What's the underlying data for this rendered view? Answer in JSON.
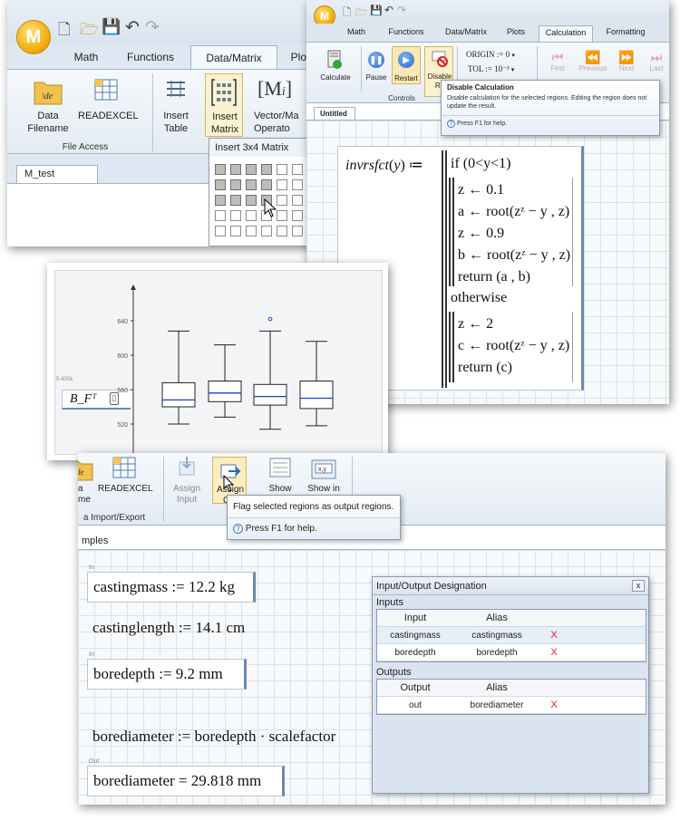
{
  "panel_a": {
    "app_logo": "M",
    "tabs": [
      "Math",
      "Functions",
      "Data/Matrix",
      "Plots"
    ],
    "active_tab": "Data/Matrix",
    "buttons": {
      "data_filename": "Data\nFilename",
      "readexcel": "READEXCEL",
      "insert_table": "Insert\nTable",
      "insert_matrix": "Insert\nMatrix",
      "vector_matrix": "Vector/Ma\nOperato"
    },
    "group_file_access": "File Access",
    "doc_tab": "M_test",
    "dropdown_title": "Insert 3x4 Matrix",
    "matrix_symbol": "M"
  },
  "panel_b": {
    "app_logo": "M",
    "tabs": [
      "Math",
      "Functions",
      "Data/Matrix",
      "Plots",
      "Calculation",
      "Formatting"
    ],
    "active_tab": "Calculation",
    "buttons": {
      "calculate": "Calculate",
      "pause": "Pause",
      "restart": "Restart",
      "disable": "Disable\nRe"
    },
    "options": {
      "origin": "ORIGIN := 0",
      "tol": "TOL := 10⁻³"
    },
    "nav": [
      "First",
      "Previous",
      "Next",
      "Last"
    ],
    "group_controls": "Controls",
    "doc_tab": "Untitled",
    "tooltip": {
      "title": "Disable Calculation",
      "body": "Disable calculation for the selected regions. Editing the region does not update the result.",
      "help": "Press F1 for help."
    },
    "program": {
      "header_name": "invrsfct",
      "header_arg": "y",
      "condition": "if (0<y<1)",
      "lines_if": [
        "z ← 0.1",
        "a ← root(zᶻ − y , z)",
        "z ← 0.9",
        "b ← root(zᶻ − y , z)",
        "return (a , b)"
      ],
      "otherwise": "otherwise",
      "lines_else": [
        "z ← 2",
        "c ← root(zᶻ − y , z)",
        "return (c)"
      ]
    }
  },
  "panel_c": {
    "region_expr": "B_Fᵀ",
    "tick_labels": [
      "640",
      "600",
      "560",
      "520"
    ],
    "side_label": "5-400k"
  },
  "panel_d": {
    "buttons": {
      "data_filename": "a\nme",
      "readexcel": "READEXCEL",
      "assign_input": "Assign\nInput",
      "assign_output": "Assign\nOut",
      "show": "Show",
      "show_in": "Show in"
    },
    "group_import_export": "a Import/Export",
    "doc_tab": "mples",
    "tooltip": {
      "title": "Flag selected regions as output regions.",
      "help": "Press F1 for help."
    },
    "worksheet": {
      "in_label": "In",
      "out_label": "Out",
      "casting_mass": "castingmass := 12.2 kg",
      "casting_length": "castinglength := 14.1 cm",
      "bore_depth": "boredepth := 9.2 mm",
      "bore_diameter_def": "borediameter := boredepth · scalefactor",
      "bore_diameter_result": "borediameter = 29.818 mm"
    },
    "io_dialog": {
      "title": "Input/Output Designation",
      "close": "x",
      "inputs_label": "Inputs",
      "inputs_headers": [
        "Input",
        "Alias"
      ],
      "inputs_rows": [
        {
          "name": "castingmass",
          "alias": "castingmass",
          "delete": "X"
        },
        {
          "name": "boredepth",
          "alias": "boredepth",
          "delete": "X"
        }
      ],
      "outputs_label": "Outputs",
      "outputs_headers": [
        "Output",
        "Alias"
      ],
      "outputs_rows": [
        {
          "name": "out",
          "alias": "borediameter",
          "delete": "X"
        }
      ]
    }
  },
  "chart_data": {
    "type": "box",
    "title": "",
    "xlabel": "",
    "ylabel": "",
    "y_ticks": [
      520,
      560,
      600,
      640
    ],
    "ylim": [
      505,
      655
    ],
    "boxes": [
      {
        "whisker_low": 520,
        "q1": 540,
        "median": 548,
        "q3": 568,
        "whisker_high": 628
      },
      {
        "whisker_low": 528,
        "q1": 546,
        "median": 556,
        "q3": 570,
        "whisker_high": 612
      },
      {
        "whisker_low": 514,
        "q1": 542,
        "median": 552,
        "q3": 566,
        "whisker_high": 628,
        "outliers": [
          642
        ]
      },
      {
        "whisker_low": 518,
        "q1": 538,
        "median": 550,
        "q3": 570,
        "whisker_high": 616
      }
    ],
    "colors": {
      "box": "#222222",
      "median": "#1f3ec6",
      "outlier": "#1f3ec6"
    }
  }
}
